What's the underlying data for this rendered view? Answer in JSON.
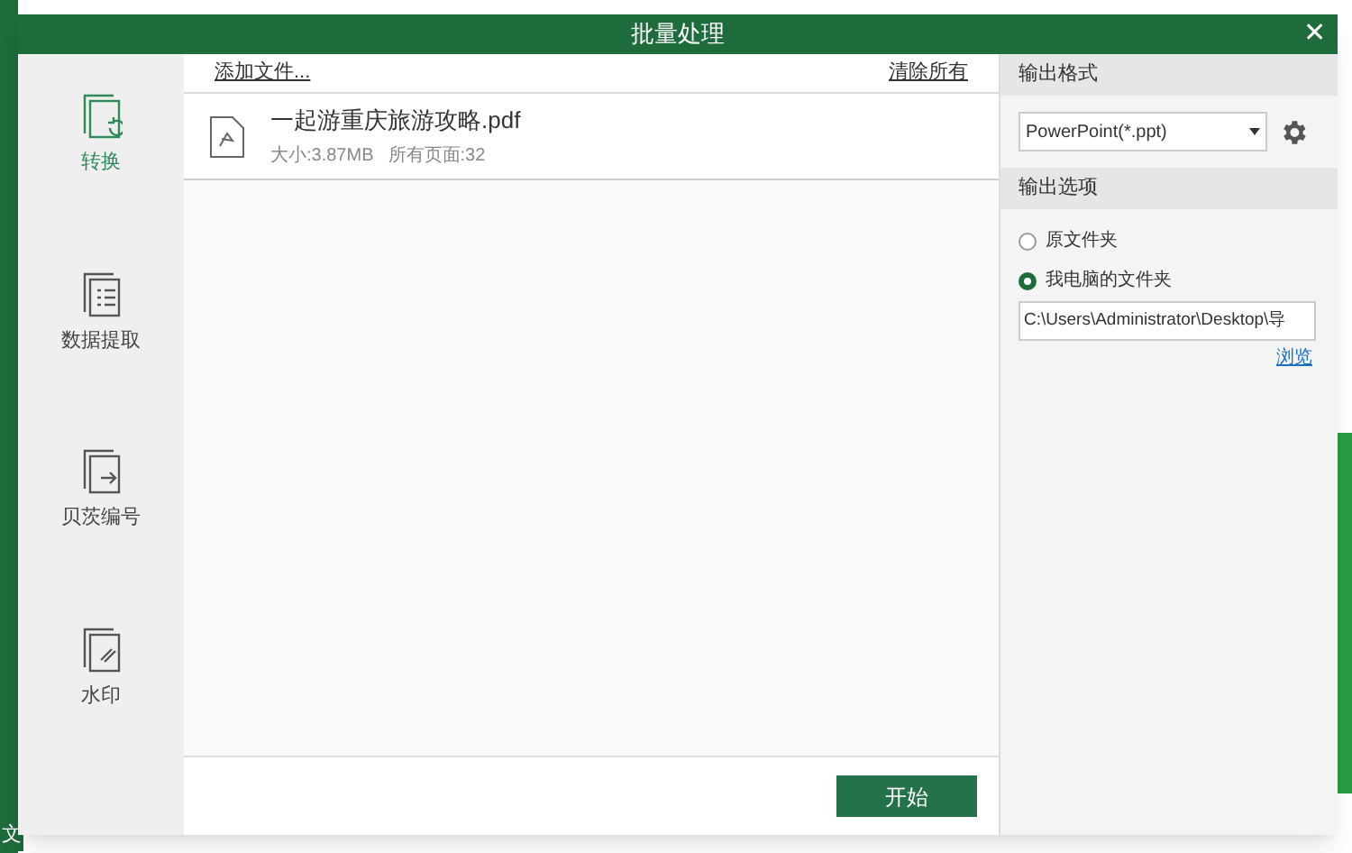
{
  "background_app": {
    "corner_text": "文"
  },
  "window": {
    "title": "批量处理",
    "close": "✕"
  },
  "sidebar": {
    "items": [
      {
        "label": "转换",
        "kind": "convert",
        "selected": true
      },
      {
        "label": "数据提取",
        "kind": "extract",
        "selected": false
      },
      {
        "label": "贝茨编号",
        "kind": "bates",
        "selected": false
      },
      {
        "label": "水印",
        "kind": "watermark",
        "selected": false
      }
    ]
  },
  "file_list": {
    "add_link": "添加文件...",
    "clear_link": "清除所有",
    "files": [
      {
        "name": "一起游重庆旅游攻略.pdf",
        "size": "大小:3.87MB",
        "pages": "所有页面:32"
      }
    ]
  },
  "start_button": "开始",
  "output_format": {
    "heading": "输出格式",
    "value": "PowerPoint(*.ppt)"
  },
  "output_options": {
    "heading": "输出选项",
    "options": [
      {
        "label": "原文件夹",
        "selected": false
      },
      {
        "label": "我电脑的文件夹",
        "selected": true
      }
    ],
    "path": "C:\\Users\\Administrator\\Desktop\\导",
    "browse": "浏览"
  }
}
